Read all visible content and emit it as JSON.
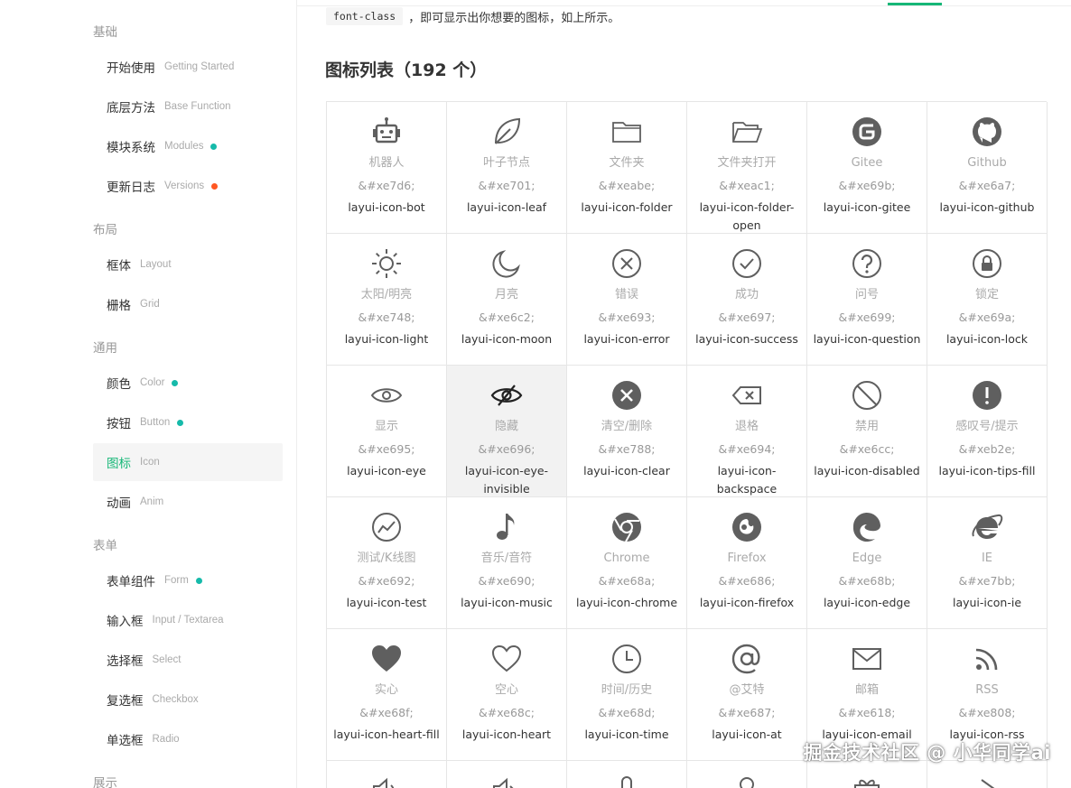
{
  "sidebar": {
    "groups": [
      "基础",
      "布局",
      "通用",
      "表单",
      "展示"
    ],
    "items": [
      {
        "zh": "开始使用",
        "en": "Getting Started"
      },
      {
        "zh": "底层方法",
        "en": "Base Function"
      },
      {
        "zh": "模块系统",
        "en": "Modules"
      },
      {
        "zh": "更新日志",
        "en": "Versions"
      },
      {
        "zh": "框体",
        "en": "Layout"
      },
      {
        "zh": "栅格",
        "en": "Grid"
      },
      {
        "zh": "颜色",
        "en": "Color"
      },
      {
        "zh": "按钮",
        "en": "Button"
      },
      {
        "zh": "图标",
        "en": "Icon"
      },
      {
        "zh": "动画",
        "en": "Anim"
      },
      {
        "zh": "表单组件",
        "en": "Form"
      },
      {
        "zh": "输入框",
        "en": "Input / Textarea"
      },
      {
        "zh": "选择框",
        "en": "Select"
      },
      {
        "zh": "复选框",
        "en": "Checkbox"
      },
      {
        "zh": "单选框",
        "en": "Radio"
      }
    ]
  },
  "colors": {
    "accent": "#16b777",
    "dot_green": "#16baaa",
    "dot_red": "#ff5722",
    "icon": "#5f5f5f"
  },
  "intro": {
    "code": "font-class",
    "text": "，即可显示出你想要的图标，如上所示。"
  },
  "title": "图标列表（192 个）",
  "icons": [
    {
      "name": "机器人",
      "code": "&#xe7d6;",
      "cls": "layui-icon-bot",
      "icon": "robot-icon"
    },
    {
      "name": "叶子节点",
      "code": "&#xe701;",
      "cls": "layui-icon-leaf",
      "icon": "leaf-icon"
    },
    {
      "name": "文件夹",
      "code": "&#xeabe;",
      "cls": "layui-icon-folder",
      "icon": "folder-icon"
    },
    {
      "name": "文件夹打开",
      "code": "&#xeac1;",
      "cls": "layui-icon-folder-open",
      "icon": "folder-open-icon"
    },
    {
      "name": "Gitee",
      "code": "&#xe69b;",
      "cls": "layui-icon-gitee",
      "icon": "gitee-icon"
    },
    {
      "name": "Github",
      "code": "&#xe6a7;",
      "cls": "layui-icon-github",
      "icon": "github-icon"
    },
    {
      "name": "太阳/明亮",
      "code": "&#xe748;",
      "cls": "layui-icon-light",
      "icon": "sun-icon"
    },
    {
      "name": "月亮",
      "code": "&#xe6c2;",
      "cls": "layui-icon-moon",
      "icon": "moon-icon"
    },
    {
      "name": "错误",
      "code": "&#xe693;",
      "cls": "layui-icon-error",
      "icon": "error-icon"
    },
    {
      "name": "成功",
      "code": "&#xe697;",
      "cls": "layui-icon-success",
      "icon": "success-icon"
    },
    {
      "name": "问号",
      "code": "&#xe699;",
      "cls": "layui-icon-question",
      "icon": "question-icon"
    },
    {
      "name": "锁定",
      "code": "&#xe69a;",
      "cls": "layui-icon-lock",
      "icon": "lock-icon"
    },
    {
      "name": "显示",
      "code": "&#xe695;",
      "cls": "layui-icon-eye",
      "icon": "eye-icon"
    },
    {
      "name": "隐藏",
      "code": "&#xe696;",
      "cls": "layui-icon-eye-invisible",
      "icon": "eye-invisible-icon"
    },
    {
      "name": "清空/删除",
      "code": "&#xe788;",
      "cls": "layui-icon-clear",
      "icon": "clear-icon"
    },
    {
      "name": "退格",
      "code": "&#xe694;",
      "cls": "layui-icon-backspace",
      "icon": "backspace-icon"
    },
    {
      "name": "禁用",
      "code": "&#xe6cc;",
      "cls": "layui-icon-disabled",
      "icon": "disabled-icon"
    },
    {
      "name": "感叹号/提示",
      "code": "&#xeb2e;",
      "cls": "layui-icon-tips-fill",
      "icon": "tips-fill-icon"
    },
    {
      "name": "测试/K线图",
      "code": "&#xe692;",
      "cls": "layui-icon-test",
      "icon": "test-icon"
    },
    {
      "name": "音乐/音符",
      "code": "&#xe690;",
      "cls": "layui-icon-music",
      "icon": "music-icon"
    },
    {
      "name": "Chrome",
      "code": "&#xe68a;",
      "cls": "layui-icon-chrome",
      "icon": "chrome-icon"
    },
    {
      "name": "Firefox",
      "code": "&#xe686;",
      "cls": "layui-icon-firefox",
      "icon": "firefox-icon"
    },
    {
      "name": "Edge",
      "code": "&#xe68b;",
      "cls": "layui-icon-edge",
      "icon": "edge-icon"
    },
    {
      "name": "IE",
      "code": "&#xe7bb;",
      "cls": "layui-icon-ie",
      "icon": "ie-icon"
    },
    {
      "name": "实心",
      "code": "&#xe68f;",
      "cls": "layui-icon-heart-fill",
      "icon": "heart-fill-icon"
    },
    {
      "name": "空心",
      "code": "&#xe68c;",
      "cls": "layui-icon-heart",
      "icon": "heart-icon"
    },
    {
      "name": "时间/历史",
      "code": "&#xe68d;",
      "cls": "layui-icon-time",
      "icon": "time-icon"
    },
    {
      "name": "@艾特",
      "code": "&#xe687;",
      "cls": "layui-icon-at",
      "icon": "at-icon"
    },
    {
      "name": "邮箱",
      "code": "&#xe618;",
      "cls": "layui-icon-email",
      "icon": "email-icon"
    },
    {
      "name": "RSS",
      "code": "&#xe808;",
      "cls": "layui-icon-rss",
      "icon": "rss-icon"
    }
  ],
  "partial_icons": [
    "speaker-icon",
    "speaker-mute-icon",
    "microphone-icon",
    "user-icon",
    "gift-icon",
    "share-icon"
  ],
  "watermark": "掘金技术社区 @ 小华同学ai"
}
